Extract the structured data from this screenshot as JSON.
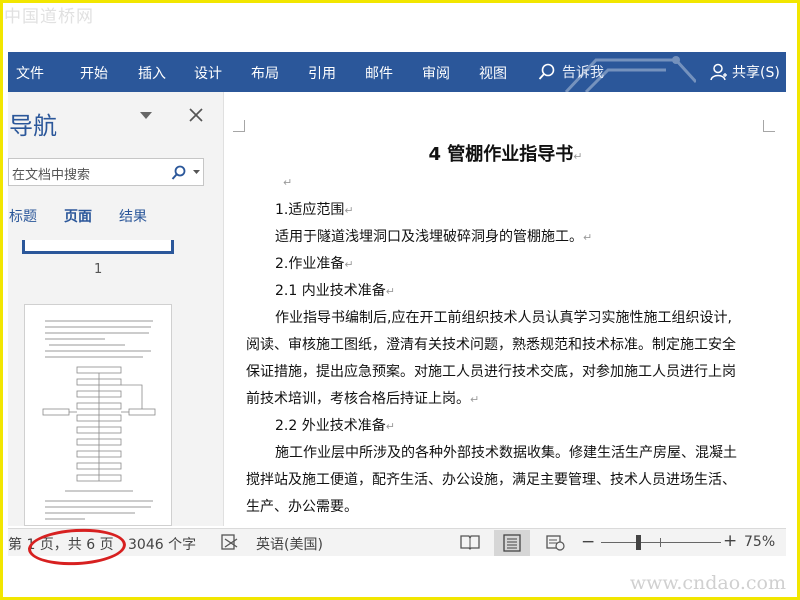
{
  "watermarks": {
    "top": "中国道桥网",
    "bottom": "www.cndao.com"
  },
  "colors": {
    "ribbon": "#2b579a",
    "frame": "#f2e600",
    "annotation": "#d72020"
  },
  "ribbon": {
    "tabs": [
      "文件",
      "开始",
      "插入",
      "设计",
      "布局",
      "引用",
      "邮件",
      "审阅",
      "视图"
    ],
    "tell_me": "告诉我",
    "share": "共享(S)",
    "icons": {
      "tell_me": "search-icon",
      "share": "person-icon"
    }
  },
  "nav": {
    "title": "导航",
    "search_placeholder": "在文档中搜索",
    "tabs": [
      "标题",
      "页面",
      "结果"
    ],
    "active_tab": "页面",
    "page1_label": "1"
  },
  "document": {
    "title": "4 管棚作业指导书",
    "lines": [
      "1.适应范围",
      "适用于隧道浅埋洞口及浅埋破碎洞身的管棚施工。",
      "2.作业准备",
      "2.1 内业技术准备",
      "作业指导书编制后,应在开工前组织技术人员认真学习实施性施工组织设计,",
      "阅读、审核施工图纸，澄清有关技术问题，熟悉规范和技术标准。制定施工安全",
      "保证措施，提出应急预案。对施工人员进行技术交底，对参加施工人员进行上岗",
      "前技术培训，考核合格后持证上岗。",
      "2.2 外业技术准备",
      "施工作业层中所涉及的各种外部技术数据收集。修建生活生产房屋、混凝土",
      "搅拌站及施工便道，配齐生活、办公设施，满足主要管理、技术人员进场生活、",
      "生产、办公需要。"
    ]
  },
  "status": {
    "page_info": "第 1 页，共 6 页",
    "word_count": "3046 个字",
    "language": "英语(美国)",
    "zoom_level": "75%",
    "zoom_fraction": 0.31
  },
  "thumbnail_text": {
    "flow_title": "图1  管棚施工工艺流程图"
  }
}
